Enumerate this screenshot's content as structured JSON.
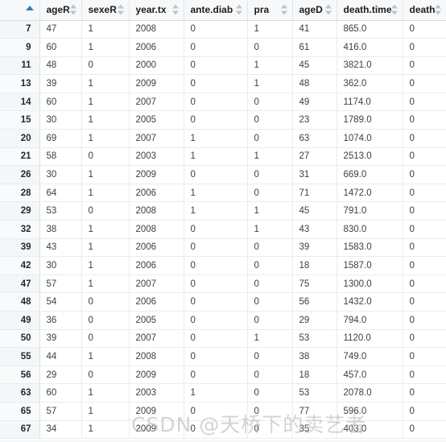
{
  "table": {
    "index_header": "",
    "index_sort": "ascending",
    "columns": [
      {
        "key": "ageR",
        "label": "ageR",
        "sort": "none"
      },
      {
        "key": "sexeR",
        "label": "sexeR",
        "sort": "none"
      },
      {
        "key": "year.tx",
        "label": "year.tx",
        "sort": "none"
      },
      {
        "key": "ante.diab",
        "label": "ante.diab",
        "sort": "none"
      },
      {
        "key": "pra",
        "label": "pra",
        "sort": "none"
      },
      {
        "key": "ageD",
        "label": "ageD",
        "sort": "none"
      },
      {
        "key": "death.time",
        "label": "death.time",
        "sort": "none"
      },
      {
        "key": "death",
        "label": "death",
        "sort": "none"
      }
    ],
    "rows": [
      {
        "index": "7",
        "ageR": "47",
        "sexeR": "1",
        "year_tx": "2008",
        "ante_diab": "0",
        "pra": "1",
        "ageD": "41",
        "death_time": "865.0",
        "death": "0"
      },
      {
        "index": "9",
        "ageR": "60",
        "sexeR": "1",
        "year_tx": "2006",
        "ante_diab": "0",
        "pra": "0",
        "ageD": "61",
        "death_time": "416.0",
        "death": "0"
      },
      {
        "index": "11",
        "ageR": "48",
        "sexeR": "0",
        "year_tx": "2000",
        "ante_diab": "0",
        "pra": "1",
        "ageD": "45",
        "death_time": "3821.0",
        "death": "0"
      },
      {
        "index": "13",
        "ageR": "39",
        "sexeR": "1",
        "year_tx": "2009",
        "ante_diab": "0",
        "pra": "1",
        "ageD": "48",
        "death_time": "362.0",
        "death": "0"
      },
      {
        "index": "14",
        "ageR": "60",
        "sexeR": "1",
        "year_tx": "2007",
        "ante_diab": "0",
        "pra": "0",
        "ageD": "49",
        "death_time": "1174.0",
        "death": "0"
      },
      {
        "index": "15",
        "ageR": "30",
        "sexeR": "1",
        "year_tx": "2005",
        "ante_diab": "0",
        "pra": "0",
        "ageD": "23",
        "death_time": "1789.0",
        "death": "0"
      },
      {
        "index": "20",
        "ageR": "69",
        "sexeR": "1",
        "year_tx": "2007",
        "ante_diab": "1",
        "pra": "0",
        "ageD": "63",
        "death_time": "1074.0",
        "death": "0"
      },
      {
        "index": "21",
        "ageR": "58",
        "sexeR": "0",
        "year_tx": "2003",
        "ante_diab": "1",
        "pra": "1",
        "ageD": "27",
        "death_time": "2513.0",
        "death": "0"
      },
      {
        "index": "26",
        "ageR": "30",
        "sexeR": "1",
        "year_tx": "2009",
        "ante_diab": "0",
        "pra": "0",
        "ageD": "31",
        "death_time": "669.0",
        "death": "0"
      },
      {
        "index": "28",
        "ageR": "64",
        "sexeR": "1",
        "year_tx": "2006",
        "ante_diab": "1",
        "pra": "0",
        "ageD": "71",
        "death_time": "1472.0",
        "death": "0"
      },
      {
        "index": "29",
        "ageR": "53",
        "sexeR": "0",
        "year_tx": "2008",
        "ante_diab": "1",
        "pra": "1",
        "ageD": "45",
        "death_time": "791.0",
        "death": "0"
      },
      {
        "index": "32",
        "ageR": "38",
        "sexeR": "1",
        "year_tx": "2008",
        "ante_diab": "0",
        "pra": "1",
        "ageD": "43",
        "death_time": "830.0",
        "death": "0"
      },
      {
        "index": "39",
        "ageR": "43",
        "sexeR": "1",
        "year_tx": "2006",
        "ante_diab": "0",
        "pra": "0",
        "ageD": "39",
        "death_time": "1583.0",
        "death": "0"
      },
      {
        "index": "42",
        "ageR": "30",
        "sexeR": "1",
        "year_tx": "2006",
        "ante_diab": "0",
        "pra": "0",
        "ageD": "18",
        "death_time": "1587.0",
        "death": "0"
      },
      {
        "index": "47",
        "ageR": "57",
        "sexeR": "1",
        "year_tx": "2007",
        "ante_diab": "0",
        "pra": "0",
        "ageD": "75",
        "death_time": "1300.0",
        "death": "0"
      },
      {
        "index": "48",
        "ageR": "54",
        "sexeR": "0",
        "year_tx": "2006",
        "ante_diab": "0",
        "pra": "0",
        "ageD": "56",
        "death_time": "1432.0",
        "death": "0"
      },
      {
        "index": "49",
        "ageR": "36",
        "sexeR": "0",
        "year_tx": "2005",
        "ante_diab": "0",
        "pra": "0",
        "ageD": "29",
        "death_time": "794.0",
        "death": "0"
      },
      {
        "index": "50",
        "ageR": "39",
        "sexeR": "0",
        "year_tx": "2007",
        "ante_diab": "0",
        "pra": "1",
        "ageD": "53",
        "death_time": "1120.0",
        "death": "0"
      },
      {
        "index": "55",
        "ageR": "44",
        "sexeR": "1",
        "year_tx": "2008",
        "ante_diab": "0",
        "pra": "0",
        "ageD": "38",
        "death_time": "749.0",
        "death": "0"
      },
      {
        "index": "56",
        "ageR": "29",
        "sexeR": "0",
        "year_tx": "2009",
        "ante_diab": "0",
        "pra": "0",
        "ageD": "18",
        "death_time": "457.0",
        "death": "0"
      },
      {
        "index": "63",
        "ageR": "60",
        "sexeR": "1",
        "year_tx": "2003",
        "ante_diab": "1",
        "pra": "0",
        "ageD": "53",
        "death_time": "2078.0",
        "death": "0"
      },
      {
        "index": "65",
        "ageR": "57",
        "sexeR": "1",
        "year_tx": "2009",
        "ante_diab": "0",
        "pra": "0",
        "ageD": "77",
        "death_time": "596.0",
        "death": "0"
      },
      {
        "index": "67",
        "ageR": "34",
        "sexeR": "1",
        "year_tx": "2009",
        "ante_diab": "0",
        "pra": "0",
        "ageD": "35",
        "death_time": "403.0",
        "death": "0"
      }
    ]
  },
  "watermark": {
    "text": "CSDN @天桥下的卖艺者"
  },
  "colors": {
    "sort_active": "#2e7ebb",
    "sort_inactive": "#b6bcc2",
    "header_bg": "#f7f8f9",
    "index_bg": "#f6f8f9",
    "grid_line": "#e9ecef"
  }
}
